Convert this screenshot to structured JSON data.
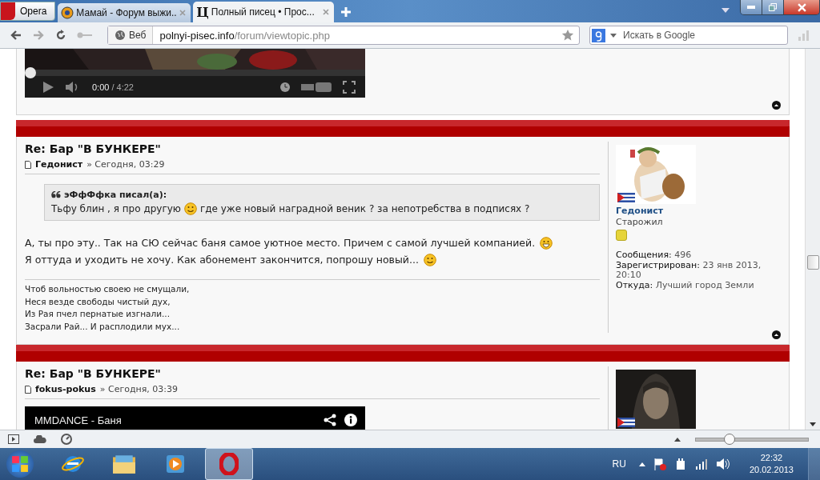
{
  "browser": {
    "menu_button": "Opera",
    "tabs": [
      {
        "title": "Мамай - Форум выжи...",
        "selected": false
      },
      {
        "icon_text": "Ц",
        "title": "Полный писец • Прос...",
        "selected": true
      }
    ],
    "address": {
      "badge": "Веб",
      "domain": "polnyi-pisec.info",
      "path": "/forum/viewtopic.php"
    },
    "search": {
      "placeholder": "Искать в Google"
    }
  },
  "video_player": {
    "time": "0:00",
    "duration": "/ 4:22",
    "level": 0
  },
  "posts": [
    {
      "title": "Re: Бар \"В БУНКЕРЕ\"",
      "author": "Гедонист",
      "date": "» Сегодня, 03:29",
      "quote": {
        "author": "эФфФфка писал(а):",
        "text_before": "Тьфу блин , я про другую",
        "text_after": "где уже новый наградной веник ? за непотребства в подписях ?"
      },
      "body": [
        "А, ты про эту.. Так на СЮ сейчас баня самое уютное место. Причем с самой лучшей компанией.",
        "Я оттуда и уходить не хочу. Как абонемент закончится, попрошу новый..."
      ],
      "signature": [
        "Чтоб вольностью своею не смущали,",
        "Неся везде свободы чистый дух,",
        "Из Рая пчел пернатые изгнали...",
        "Засрали Рай... И расплодили мух..."
      ],
      "profile": {
        "name": "Гедонист",
        "rank": "Старожил",
        "fields": [
          {
            "label": "Сообщения:",
            "value": "496"
          },
          {
            "label": "Зарегистрирован:",
            "value": "23 янв 2013, 20:10"
          },
          {
            "label": "Откуда:",
            "value": "Лучший город Земли"
          }
        ]
      }
    },
    {
      "title": "Re: Бар \"В БУНКЕРЕ\"",
      "author": "fokus-pokus",
      "date": "» Сегодня, 03:39",
      "video_title": "MMDANCE - Баня"
    }
  ],
  "status_bar": {
    "zoom": {
      "level": 0.29
    }
  },
  "taskbar": {
    "language": "RU",
    "time": "22:32",
    "date": "20.02.2013"
  }
}
